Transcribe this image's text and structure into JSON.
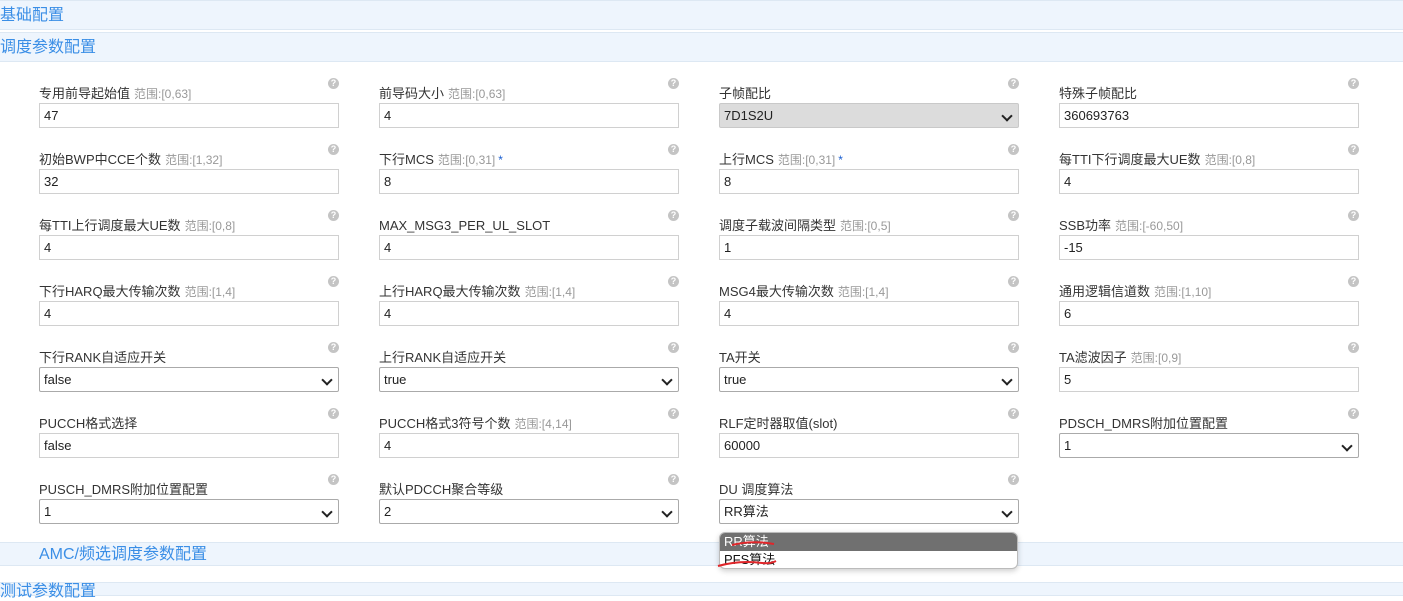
{
  "sections": {
    "basic": "基础配置",
    "sched": "调度参数配置",
    "amc": "AMC/频选调度参数配置",
    "test": "测试参数配置"
  },
  "help_glyph": "?",
  "fields": [
    {
      "label": "专用前导起始值",
      "range": "范围:[0,63]",
      "value": "47",
      "type": "input"
    },
    {
      "label": "前导码大小",
      "range": "范围:[0,63]",
      "value": "4",
      "type": "input"
    },
    {
      "label": "子帧配比",
      "range": "",
      "value": "7D1S2U",
      "type": "select-grey"
    },
    {
      "label": "特殊子帧配比",
      "range": "",
      "value": "360693763",
      "type": "input"
    },
    {
      "label": "初始BWP中CCE个数",
      "range": "范围:[1,32]",
      "value": "32",
      "type": "input"
    },
    {
      "label": "下行MCS",
      "range": "范围:[0,31]",
      "required": "*",
      "value": "8",
      "type": "input"
    },
    {
      "label": "上行MCS",
      "range": "范围:[0,31]",
      "required": "*",
      "value": "8",
      "type": "input"
    },
    {
      "label": "每TTI下行调度最大UE数",
      "range": "范围:[0,8]",
      "value": "4",
      "type": "input"
    },
    {
      "label": "每TTI上行调度最大UE数",
      "range": "范围:[0,8]",
      "value": "4",
      "type": "input"
    },
    {
      "label": "MAX_MSG3_PER_UL_SLOT",
      "range": "",
      "value": "4",
      "type": "input"
    },
    {
      "label": "调度子载波间隔类型",
      "range": "范围:[0,5]",
      "value": "1",
      "type": "input"
    },
    {
      "label": "SSB功率",
      "range": "范围:[-60,50]",
      "value": "-15",
      "type": "input"
    },
    {
      "label": "下行HARQ最大传输次数",
      "range": "范围:[1,4]",
      "value": "4",
      "type": "input"
    },
    {
      "label": "上行HARQ最大传输次数",
      "range": "范围:[1,4]",
      "value": "4",
      "type": "input"
    },
    {
      "label": "MSG4最大传输次数",
      "range": "范围:[1,4]",
      "value": "4",
      "type": "input"
    },
    {
      "label": "通用逻辑信道数",
      "range": "范围:[1,10]",
      "value": "6",
      "type": "input"
    },
    {
      "label": "下行RANK自适应开关",
      "range": "",
      "value": "false",
      "type": "select"
    },
    {
      "label": "上行RANK自适应开关",
      "range": "",
      "value": "true",
      "type": "select"
    },
    {
      "label": "TA开关",
      "range": "",
      "value": "true",
      "type": "select"
    },
    {
      "label": "TA滤波因子",
      "range": "范围:[0,9]",
      "value": "5",
      "type": "input"
    },
    {
      "label": "PUCCH格式选择",
      "range": "",
      "value": "false",
      "type": "input"
    },
    {
      "label": "PUCCH格式3符号个数",
      "range": "范围:[4,14]",
      "value": "4",
      "type": "input"
    },
    {
      "label": "RLF定时器取值(slot)",
      "range": "",
      "value": "60000",
      "type": "input"
    },
    {
      "label": "PDSCH_DMRS附加位置配置",
      "range": "",
      "value": "1",
      "type": "select"
    },
    {
      "label": "PUSCH_DMRS附加位置配置",
      "range": "",
      "value": "1",
      "type": "select"
    },
    {
      "label": "默认PDCCH聚合等级",
      "range": "",
      "value": "2",
      "type": "select"
    },
    {
      "label": "DU 调度算法",
      "range": "",
      "value": "RR算法",
      "type": "select"
    }
  ],
  "dropdown": {
    "options": [
      "RR算法",
      "PFS算法"
    ],
    "selected_index": 0
  },
  "colors": {
    "section_text": "#3a8ee6",
    "section_bg": "#eef5fd",
    "scribble": "#e0262a"
  }
}
